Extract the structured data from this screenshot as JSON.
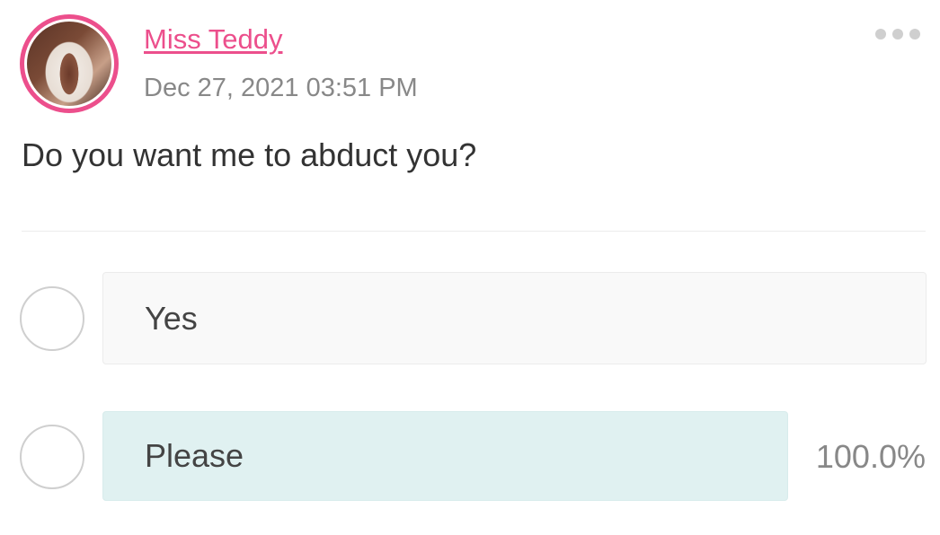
{
  "post": {
    "author": "Miss Teddy",
    "timestamp": "Dec 27, 2021 03:51 PM",
    "question": "Do you want me to abduct you?"
  },
  "poll": {
    "options": [
      {
        "label": "Yes",
        "percent": ""
      },
      {
        "label": "Please",
        "percent": "100.0%"
      }
    ]
  },
  "colors": {
    "accent": "#ec4f8c",
    "selected_option_bg": "#e0f1f1"
  },
  "icons": {
    "menu": "more-dots-icon"
  }
}
